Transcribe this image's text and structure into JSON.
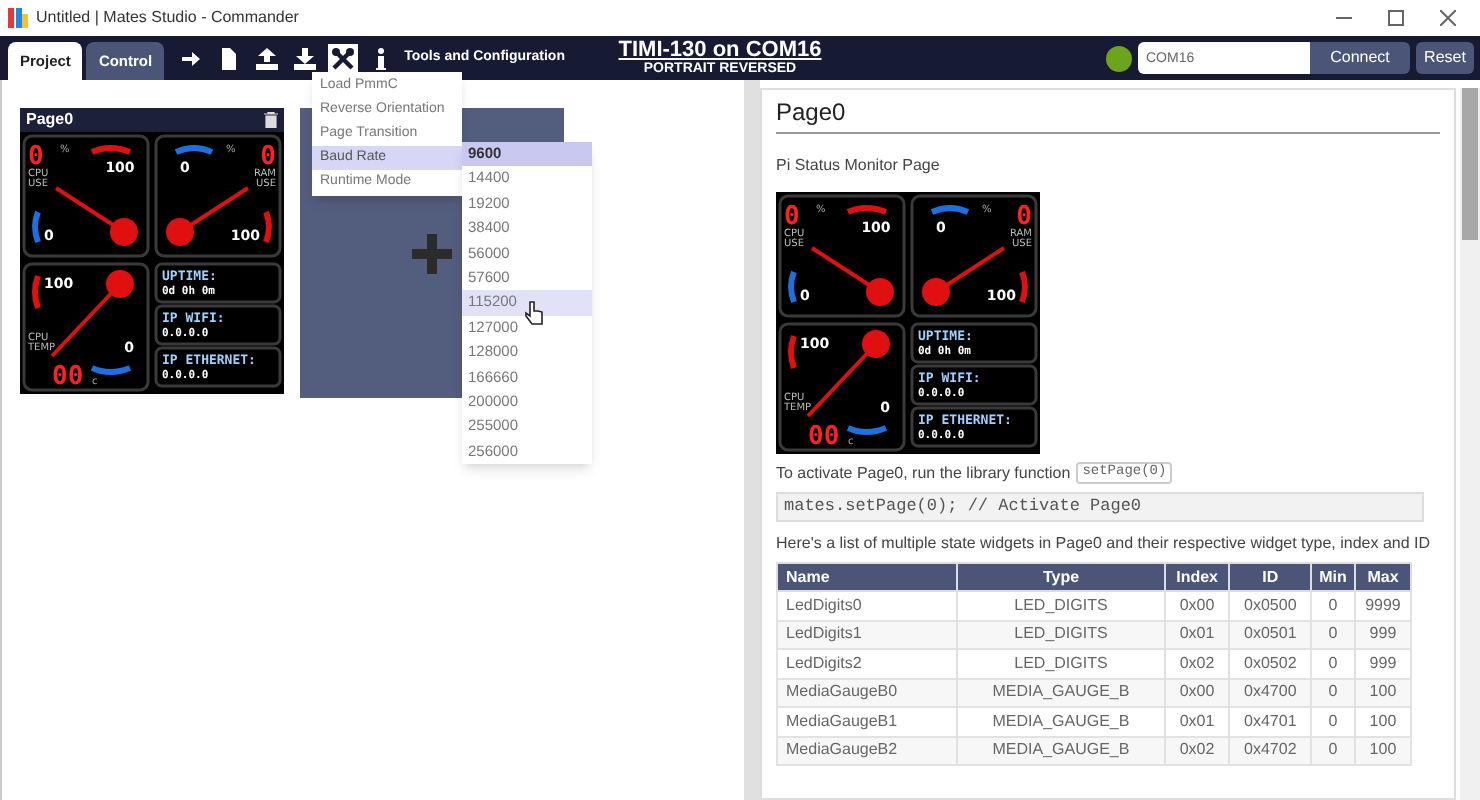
{
  "window": {
    "title": "Untitled | Mates Studio - Commander"
  },
  "tabs": [
    {
      "label": "Project",
      "selected": true
    },
    {
      "label": "Control",
      "selected": false
    }
  ],
  "toolbar_buttons": [
    {
      "kind": "arrow",
      "active": false
    },
    {
      "kind": "file",
      "active": false
    },
    {
      "kind": "upload",
      "active": false
    },
    {
      "kind": "download",
      "active": false
    },
    {
      "kind": "tools",
      "active": true
    },
    {
      "kind": "info",
      "active": false
    }
  ],
  "toolbar_caption": "Tools and Configuration",
  "device": {
    "title": "TIMI-130 on COM16",
    "subtitle": "PORTRAIT REVERSED"
  },
  "port_field": {
    "value": "COM16"
  },
  "buttons": [
    "Connect",
    "Reset"
  ],
  "tools_menu": [
    {
      "label": "Load PmmC",
      "expanded": false
    },
    {
      "label": "Reverse Orientation",
      "expanded": false
    },
    {
      "label": "Page Transition",
      "expanded": false
    },
    {
      "label": "Baud Rate",
      "expanded": true
    },
    {
      "label": "Runtime Mode",
      "expanded": false
    }
  ],
  "baud_rates": [
    {
      "label": "9600",
      "selected": true,
      "hovered": false
    },
    {
      "label": "14400",
      "selected": false,
      "hovered": false
    },
    {
      "label": "19200",
      "selected": false,
      "hovered": false
    },
    {
      "label": "38400",
      "selected": false,
      "hovered": false
    },
    {
      "label": "56000",
      "selected": false,
      "hovered": false
    },
    {
      "label": "57600",
      "selected": false,
      "hovered": false
    },
    {
      "label": "115200",
      "selected": false,
      "hovered": true
    },
    {
      "label": "127000",
      "selected": false,
      "hovered": false
    },
    {
      "label": "128000",
      "selected": false,
      "hovered": false
    },
    {
      "label": "166660",
      "selected": false,
      "hovered": false
    },
    {
      "label": "200000",
      "selected": false,
      "hovered": false
    },
    {
      "label": "255000",
      "selected": false,
      "hovered": false
    },
    {
      "label": "256000",
      "selected": false,
      "hovered": false
    }
  ],
  "pages": [
    {
      "title": "Page0",
      "display": {
        "gauges": [
          {
            "label": "CPU USE",
            "digits": "0",
            "unit": "%",
            "max": "100",
            "min": "0"
          },
          {
            "label": "RAM USE",
            "digits": "0",
            "unit": "%",
            "max": "100",
            "min": "0"
          },
          {
            "label": "CPU TEMP",
            "digits": "00",
            "unit": "c",
            "max": "100",
            "min": "0"
          }
        ],
        "info": [
          {
            "title": "UPTIME:",
            "value": "0d 0h 0m"
          },
          {
            "title": "IP WIFI:",
            "value": "0.0.0.0"
          },
          {
            "title": "IP ETHERNET:",
            "value": "0.0.0.0"
          }
        ]
      }
    }
  ],
  "details": {
    "heading": "Page0",
    "description": "Pi Status Monitor Page",
    "display": {
      "gauges": [
        {
          "label": "CPU USE",
          "digits": "0",
          "unit": "%",
          "max": "100",
          "min": "0"
        },
        {
          "label": "RAM USE",
          "digits": "0",
          "unit": "%",
          "max": "100",
          "min": "0"
        },
        {
          "label": "CPU TEMP",
          "digits": "00",
          "unit": "c",
          "max": "100",
          "min": "0"
        }
      ],
      "info": [
        {
          "title": "UPTIME:",
          "value": "0d 0h 0m"
        },
        {
          "title": "IP WIFI:",
          "value": "0.0.0.0"
        },
        {
          "title": "IP ETHERNET:",
          "value": "0.0.0.0"
        }
      ]
    },
    "activate_text": "To activate Page0, run the library function",
    "activate_code": "setPage(0)",
    "code_block": "mates.setPage(0); // Activate Page0",
    "list_intro": "Here's a list of multiple state widgets in Page0 and their respective widget type, index and ID",
    "table": {
      "columns": [
        "Name",
        "Type",
        "Index",
        "ID",
        "Min",
        "Max"
      ],
      "rows": [
        [
          "LedDigits0",
          "LED_DIGITS",
          "0x00",
          "0x0500",
          "0",
          "9999"
        ],
        [
          "LedDigits1",
          "LED_DIGITS",
          "0x01",
          "0x0501",
          "0",
          "999"
        ],
        [
          "LedDigits2",
          "LED_DIGITS",
          "0x02",
          "0x0502",
          "0",
          "999"
        ],
        [
          "MediaGaugeB0",
          "MEDIA_GAUGE_B",
          "0x00",
          "0x4700",
          "0",
          "100"
        ],
        [
          "MediaGaugeB1",
          "MEDIA_GAUGE_B",
          "0x01",
          "0x4701",
          "0",
          "100"
        ],
        [
          "MediaGaugeB2",
          "MEDIA_GAUGE_B",
          "0x02",
          "0x4702",
          "0",
          "100"
        ]
      ]
    }
  }
}
